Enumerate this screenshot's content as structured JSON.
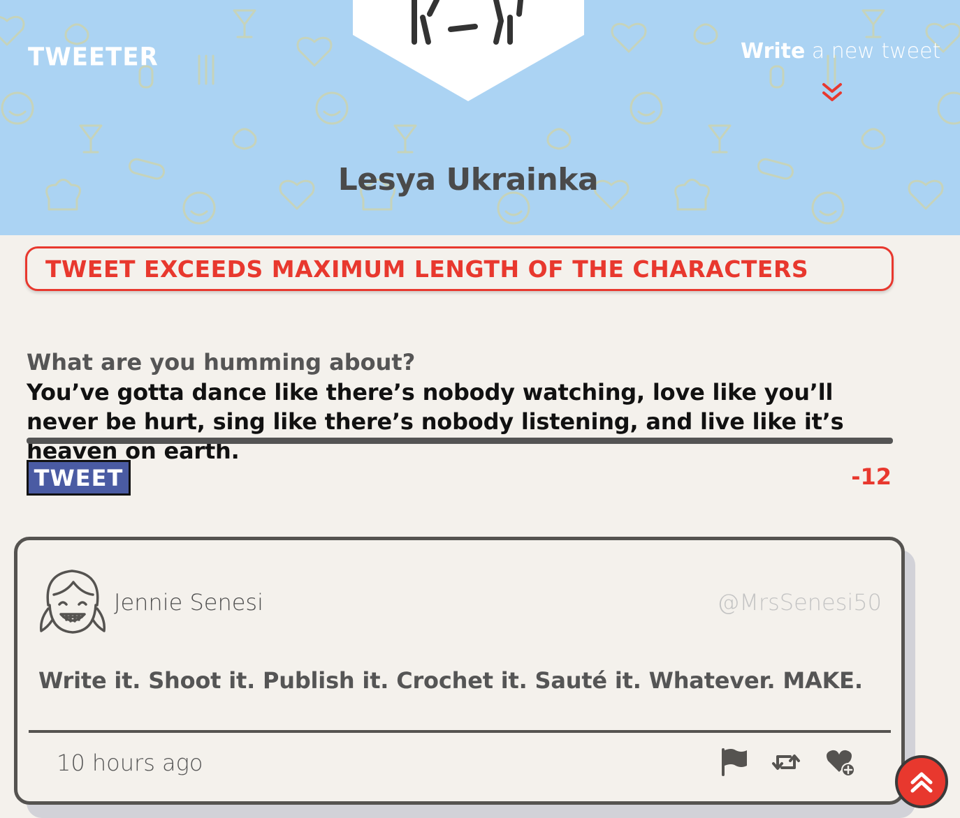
{
  "header": {
    "brand": "Tweeter",
    "profile_name": "Lesya Ukrainka",
    "compose_toggle": {
      "bold": "Write",
      "rest": " a new tweet"
    },
    "background_color": "#abd3f3"
  },
  "error": {
    "message": "Tweet exceeds maximum length of the characters",
    "color": "#e8382e"
  },
  "compose": {
    "label": "What are you humming about?",
    "text": "You’ve gotta dance like there’s nobody watching, love like you’ll never be hurt, sing like there’s nobody listening, and live like it’s heaven on earth.",
    "button_label": "Tweet",
    "counter": "-12"
  },
  "tweets": [
    {
      "name": "Jennie Senesi",
      "handle": "@MrsSenesi50",
      "content": "Write it. Shoot it. Publish it. Crochet it. Sauté it. Whatever. MAKE.",
      "time": "10 hours ago",
      "actions": [
        "flag-icon",
        "retweet-icon",
        "heart-plus-icon"
      ]
    }
  ],
  "icons": {
    "scroll_top": "double-chevron-up-icon",
    "compose_toggle": "double-chevron-down-icon"
  }
}
